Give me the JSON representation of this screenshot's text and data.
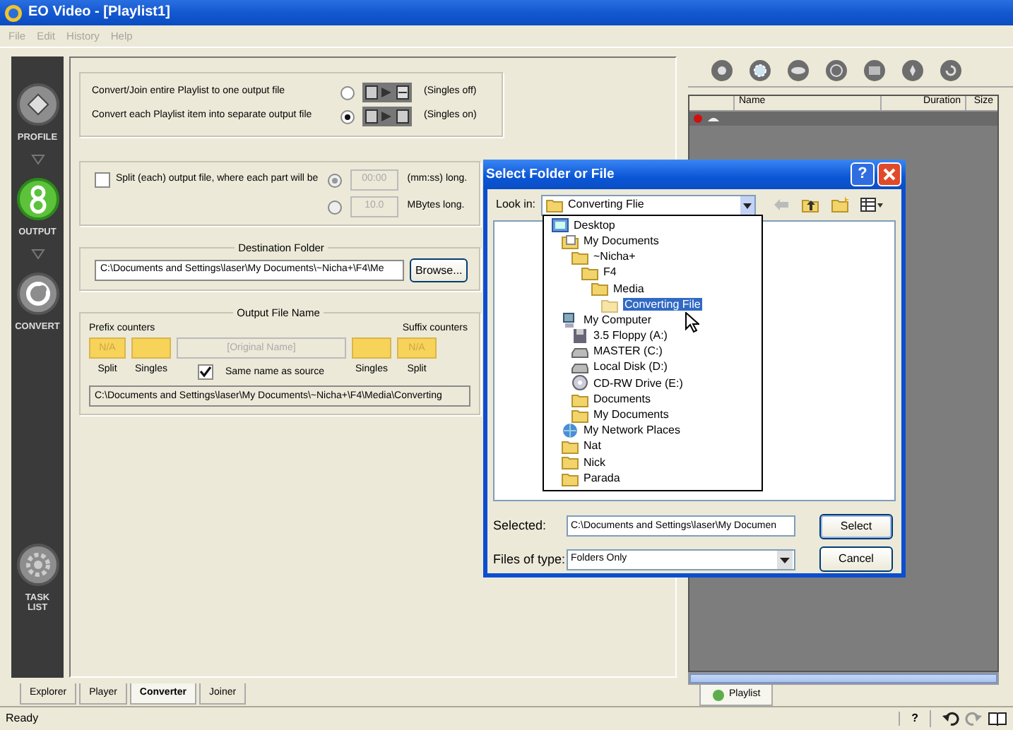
{
  "window": {
    "title": "EO Video - [Playlist1]"
  },
  "menu": [
    {
      "label": "File",
      "disabled": true
    },
    {
      "label": "Edit",
      "disabled": true
    },
    {
      "label": "History",
      "disabled": true
    },
    {
      "label": "Help",
      "disabled": true
    }
  ],
  "sidebar": [
    {
      "label": "PROFILE",
      "kind": "profile",
      "selected": false
    },
    {
      "label": "OUTPUT",
      "kind": "output",
      "selected": true
    },
    {
      "label": "CONVERT",
      "kind": "convert",
      "selected": false
    },
    {
      "label": "TASK LIST",
      "kind": "tasks",
      "selected": false
    }
  ],
  "mode": [
    {
      "label": "Convert/Join entire Playlist to one output file",
      "kind": "join",
      "selected": false,
      "note": "(Singles off)"
    },
    {
      "label": "Convert each Playlist item into separate output file",
      "kind": "singles",
      "selected": true,
      "note": "(Singles on)"
    }
  ],
  "split": {
    "label": "Split (each) output file, where each part will be",
    "checked": false,
    "options": [
      {
        "value": "00:00",
        "unit": "(mm:ss) long.",
        "selected": true,
        "disabled": true
      },
      {
        "value": "10.0",
        "unit": "MBytes long.",
        "selected": false,
        "disabled": true
      }
    ]
  },
  "destination": {
    "title": "Destination Folder",
    "path": "C:\\Documents and Settings\\laser\\My Documents\\~Nicha+\\F4\\Me",
    "button": "Browse..."
  },
  "output_name": {
    "title": "Output File Name",
    "prefix_label": "Prefix counters",
    "suffix_label": "Suffix counters",
    "prefix": [
      {
        "value": "N/A",
        "label": "Split"
      },
      {
        "label": "Singles"
      }
    ],
    "name_placeholder": "[Original Name]",
    "suffix": [
      {
        "label": "Singles"
      },
      {
        "value": "N/A",
        "label": "Split"
      }
    ],
    "same_name": {
      "label": "Same name as source",
      "checked": true
    },
    "preview": "C:\\Documents and Settings\\laser\\My Documents\\~Nicha+\\F4\\Media\\Converting"
  },
  "bottom_tabs": [
    {
      "label": "Explorer",
      "selected": false
    },
    {
      "label": "Player",
      "selected": false
    },
    {
      "label": "Converter",
      "selected": true
    },
    {
      "label": "Joiner",
      "selected": false
    }
  ],
  "playlist": {
    "columns": [
      "Name",
      "Duration",
      "Size"
    ],
    "rows": [
      {
        "color": "#d01010"
      }
    ],
    "tab": {
      "label": "Playlist",
      "selected": true
    }
  },
  "status_bar": {
    "text": "Ready",
    "help": "?"
  },
  "dialog": {
    "title": "Select Folder or File",
    "help": "?",
    "look_in_label": "Look in:",
    "look_in": "Converting Flie",
    "tree": [
      {
        "label": "Desktop",
        "kind": "desktop",
        "selected": false,
        "children": [
          {
            "label": "My Documents",
            "kind": "documents",
            "selected": false,
            "children": [
              {
                "label": "~Nicha+",
                "kind": "folder",
                "selected": false,
                "children": [
                  {
                    "label": "F4",
                    "kind": "folder",
                    "selected": false,
                    "children": [
                      {
                        "label": "Media",
                        "kind": "folder",
                        "selected": false,
                        "children": [
                          {
                            "label": "Converting File",
                            "kind": "folder",
                            "selected": true
                          }
                        ]
                      }
                    ]
                  }
                ]
              }
            ]
          },
          {
            "label": "My Computer",
            "kind": "computer",
            "selected": false,
            "children": [
              {
                "label": "3.5 Floppy (A:)",
                "kind": "floppy",
                "selected": false
              },
              {
                "label": "MASTER (C:)",
                "kind": "drive",
                "selected": false
              },
              {
                "label": "Local Disk (D:)",
                "kind": "drive",
                "selected": false
              },
              {
                "label": "CD-RW Drive (E:)",
                "kind": "cdrom",
                "selected": false
              },
              {
                "label": "Documents",
                "kind": "folder",
                "selected": false
              },
              {
                "label": "My Documents",
                "kind": "folder",
                "selected": false
              }
            ]
          },
          {
            "label": "My Network Places",
            "kind": "network",
            "selected": false
          },
          {
            "label": "Nat",
            "kind": "folder",
            "selected": false
          },
          {
            "label": "Nick",
            "kind": "folder",
            "selected": false
          },
          {
            "label": "Parada",
            "kind": "folder",
            "selected": false
          }
        ]
      }
    ],
    "selected_label": "Selected:",
    "selected_path": "C:\\Documents and Settings\\laser\\My Documen",
    "type_label": "Files of type:",
    "type_value": "Folders Only",
    "buttons": [
      {
        "label": "Select",
        "default": true
      },
      {
        "label": "Cancel",
        "default": false
      }
    ]
  }
}
